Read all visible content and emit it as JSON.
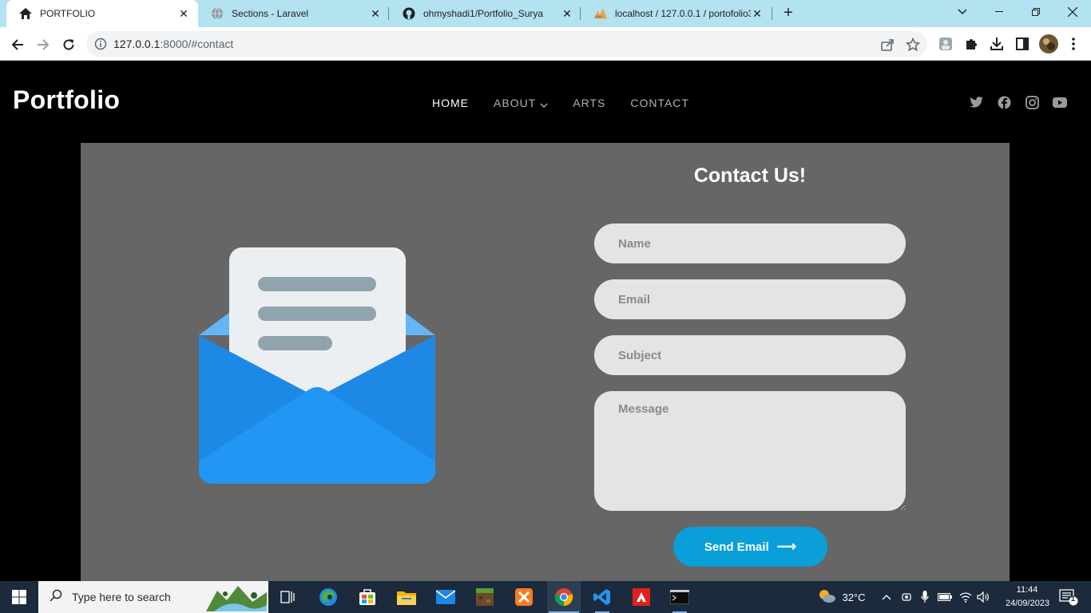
{
  "browser": {
    "tabs": [
      {
        "title": "PORTFOLIO",
        "icon": "home-icon",
        "active": true
      },
      {
        "title": "Sections - Laravel",
        "icon": "globe-icon",
        "active": false
      },
      {
        "title": "ohmyshadi1/Portfolio_Surya",
        "icon": "github-icon",
        "active": false
      },
      {
        "title": "localhost / 127.0.0.1 / portofolio3",
        "icon": "phpmyadmin-icon",
        "active": false
      }
    ],
    "url_host": "127.0.0.1",
    "url_rest": ":8000/#contact"
  },
  "site": {
    "brand": "Portfolio",
    "nav": [
      {
        "label": "HOME",
        "active": true
      },
      {
        "label": "ABOUT",
        "dropdown": true
      },
      {
        "label": "ARTS"
      },
      {
        "label": "CONTACT"
      }
    ],
    "socials": [
      "twitter-icon",
      "facebook-icon",
      "instagram-icon",
      "youtube-icon"
    ]
  },
  "contact": {
    "title": "Contact Us!",
    "name_placeholder": "Name",
    "email_placeholder": "Email",
    "subject_placeholder": "Subject",
    "message_placeholder": "Message",
    "send_label": "Send Email",
    "send_arrow": "⟶"
  },
  "taskbar": {
    "search_placeholder": "Type here to search",
    "weather": "32°C",
    "time": "11:44",
    "date": "24/09/2023",
    "notification_count": "1"
  },
  "colors": {
    "tabstrip": "#b3e2f0",
    "section_bg": "#666666",
    "button": "#0a9fd8",
    "field_bg": "#e4e4e4"
  }
}
